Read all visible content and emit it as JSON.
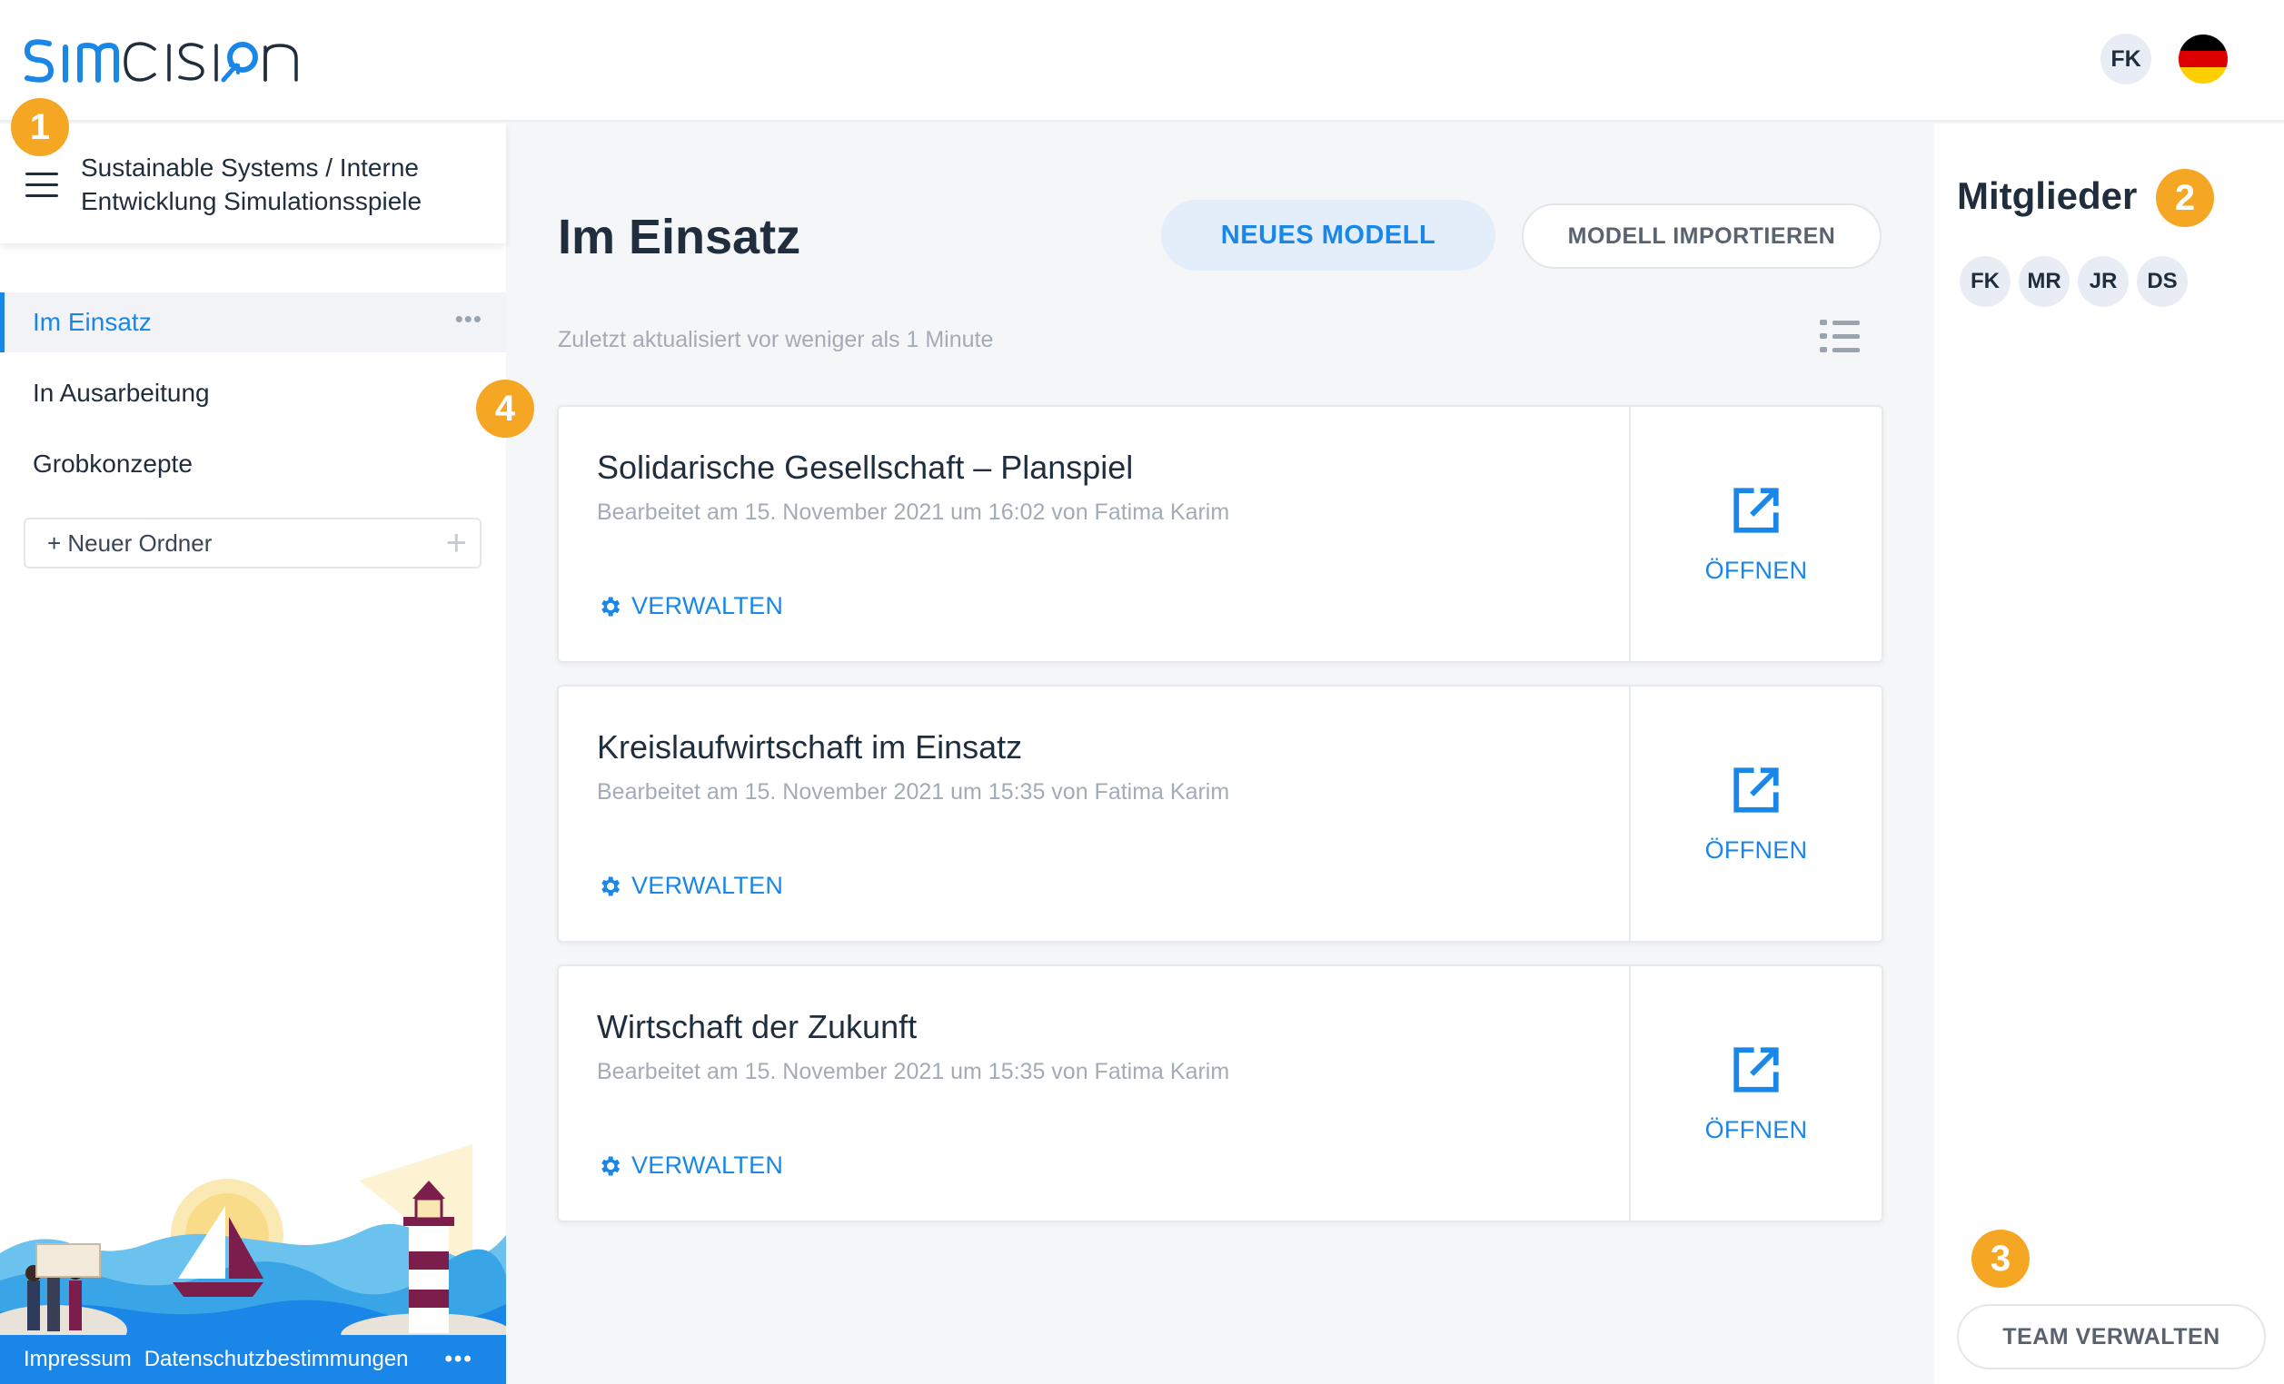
{
  "logo": {
    "text": "simcision",
    "color": "#1a87e8"
  },
  "header": {
    "user_initials": "FK",
    "language_flag": "de-flag-icon",
    "flag_colors": [
      "#000000",
      "#dd0000",
      "#ffce00"
    ]
  },
  "sidebar": {
    "breadcrumb_line1": "Sustainable Systems / Interne",
    "breadcrumb_line2": "Entwicklung Simulationsspiele",
    "folders": [
      {
        "label": "Im Einsatz",
        "active": true
      },
      {
        "label": "In Ausarbeitung",
        "active": false
      },
      {
        "label": "Grobkonzepte",
        "active": false
      }
    ],
    "more_label": "•••",
    "new_folder_placeholder": "+ Neuer Ordner",
    "new_folder_plus": "+",
    "footer": {
      "impressum": "Impressum",
      "privacy": "Datenschutzbestimmungen",
      "more": "•••"
    }
  },
  "badges": [
    "1",
    "2",
    "3",
    "4"
  ],
  "main": {
    "title": "Im Einsatz",
    "new_model_label": "NEUES MODELL",
    "import_model_label": "MODELL IMPORTIEREN",
    "updated_text": "Zuletzt aktualisiert vor weniger als 1 Minute",
    "manage_label": "VERWALTEN",
    "open_label": "ÖFFNEN",
    "models": [
      {
        "title": "Solidarische Gesellschaft – Planspiel",
        "meta": "Bearbeitet am 15. November 2021 um 16:02 von Fatima Karim"
      },
      {
        "title": "Kreislaufwirtschaft im Einsatz",
        "meta": "Bearbeitet am 15. November 2021 um 15:35 von Fatima Karim"
      },
      {
        "title": "Wirtschaft der Zukunft",
        "meta": "Bearbeitet am 15. November 2021 um 15:35 von Fatima Karim"
      }
    ]
  },
  "members": {
    "title": "Mitglieder",
    "list": [
      "FK",
      "MR",
      "JR",
      "DS"
    ],
    "team_button": "TEAM VERWALTEN"
  },
  "colors": {
    "accent": "#1a87e8",
    "badge": "#f5a623",
    "text": "#1f2d3d",
    "muted": "#a3abb6"
  }
}
